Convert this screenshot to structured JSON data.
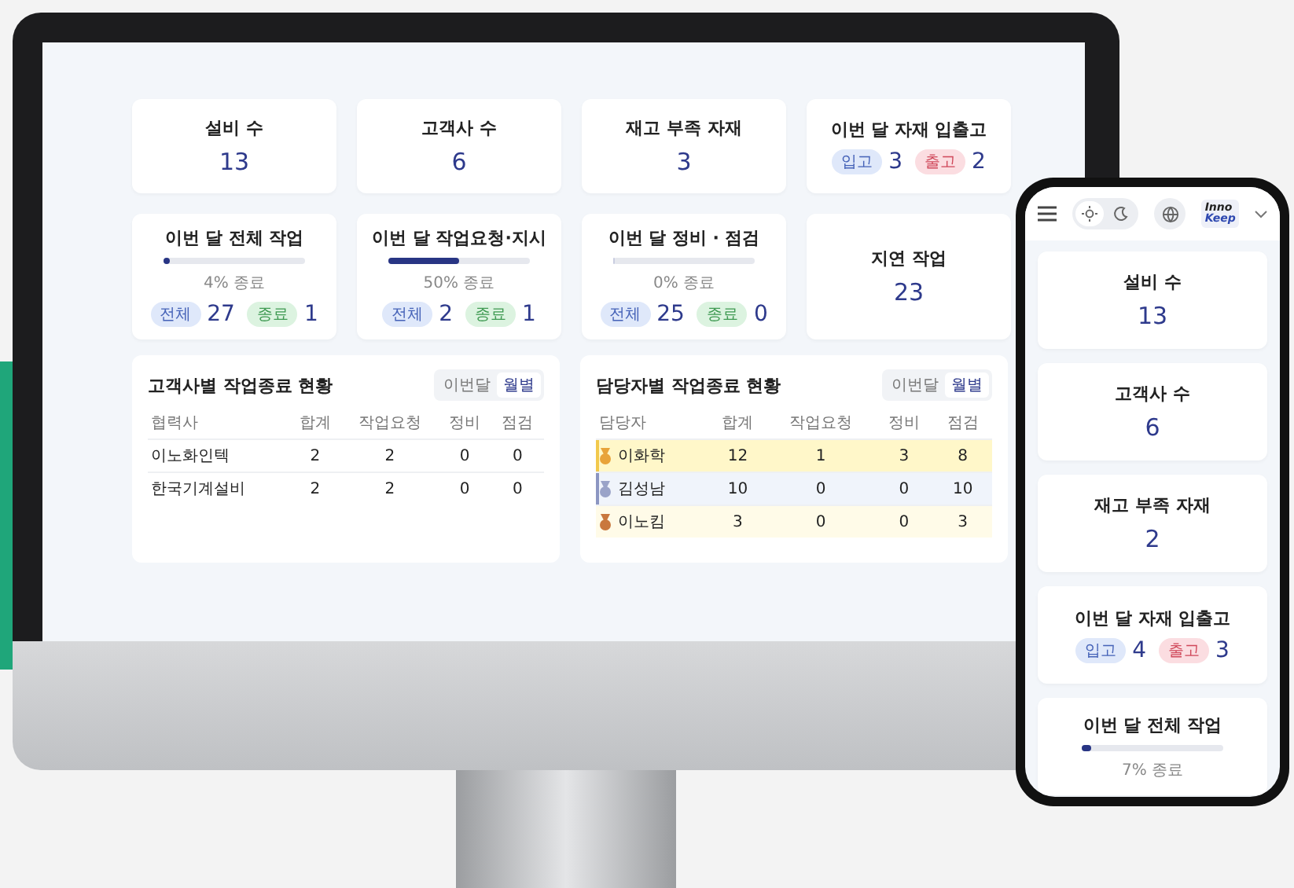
{
  "monitor": {
    "cards": [
      {
        "kind": "count",
        "title": "설비 수",
        "value": "13"
      },
      {
        "kind": "count",
        "title": "고객사 수",
        "value": "6"
      },
      {
        "kind": "count",
        "title": "재고 부족 자재",
        "value": "3"
      },
      {
        "kind": "inout",
        "title": "이번 달 자재 입출고",
        "in_label": "입고",
        "in_value": "3",
        "out_label": "출고",
        "out_value": "2"
      },
      {
        "kind": "progress",
        "title": "이번 달 전체 작업",
        "level": 0.04,
        "caption": "4% 종료",
        "total_label": "전체",
        "total_value": "27",
        "done_label": "종료",
        "done_value": "1"
      },
      {
        "kind": "progress",
        "title": "이번 달 작업요청·지시",
        "level": 0.5,
        "caption": "50% 종료",
        "total_label": "전체",
        "total_value": "2",
        "done_label": "종료",
        "done_value": "1"
      },
      {
        "kind": "progress",
        "title": "이번 달 정비 · 점검",
        "level": 0,
        "caption": "0% 종료",
        "total_label": "전체",
        "total_value": "25",
        "done_label": "종료",
        "done_value": "0"
      },
      {
        "kind": "count",
        "title": "지연 작업",
        "value": "23"
      }
    ],
    "tables": [
      {
        "title": "고객사별 작업종료 현황",
        "toggle": [
          {
            "label": "이번달",
            "selected": false
          },
          {
            "label": "월별",
            "selected": true
          }
        ],
        "columns": [
          "협력사",
          "합계",
          "작업요청",
          "정비",
          "점검"
        ],
        "rows": [
          {
            "cells": [
              "이노화인텍",
              "2",
              "2",
              "0",
              "0"
            ]
          },
          {
            "cells": [
              "한국기계설비",
              "2",
              "2",
              "0",
              "0"
            ]
          }
        ]
      },
      {
        "title": "담당자별 작업종료 현황",
        "toggle": [
          {
            "label": "이번달",
            "selected": false
          },
          {
            "label": "월별",
            "selected": true
          }
        ],
        "columns": [
          "담당자",
          "합계",
          "작업요청",
          "정비",
          "점검"
        ],
        "rows": [
          {
            "color": "#e8a33a",
            "cells": [
              "이화학",
              "12",
              "1",
              "3",
              "8"
            ]
          },
          {
            "color": "#9aa3c8",
            "cells": [
              "김성남",
              "10",
              "0",
              "0",
              "10"
            ]
          },
          {
            "color": "#c9783e",
            "cells": [
              "이노킴",
              "3",
              "0",
              "0",
              "3"
            ]
          }
        ]
      }
    ]
  },
  "phone": {
    "header": {
      "light_selected": true,
      "logo_top": "Inno",
      "logo_bottom": "Keep"
    },
    "cards": [
      {
        "kind": "count",
        "title": "설비 수",
        "value": "13"
      },
      {
        "kind": "count",
        "title": "고객사 수",
        "value": "6"
      },
      {
        "kind": "count",
        "title": "재고 부족 자재",
        "value": "2"
      },
      {
        "kind": "inout",
        "title": "이번 달 자재 입출고",
        "in_label": "입고",
        "in_value": "4",
        "out_label": "출고",
        "out_value": "3"
      },
      {
        "kind": "progress",
        "title": "이번 달 전체 작업",
        "level": 0.07,
        "caption": "7% 종료"
      }
    ]
  }
}
